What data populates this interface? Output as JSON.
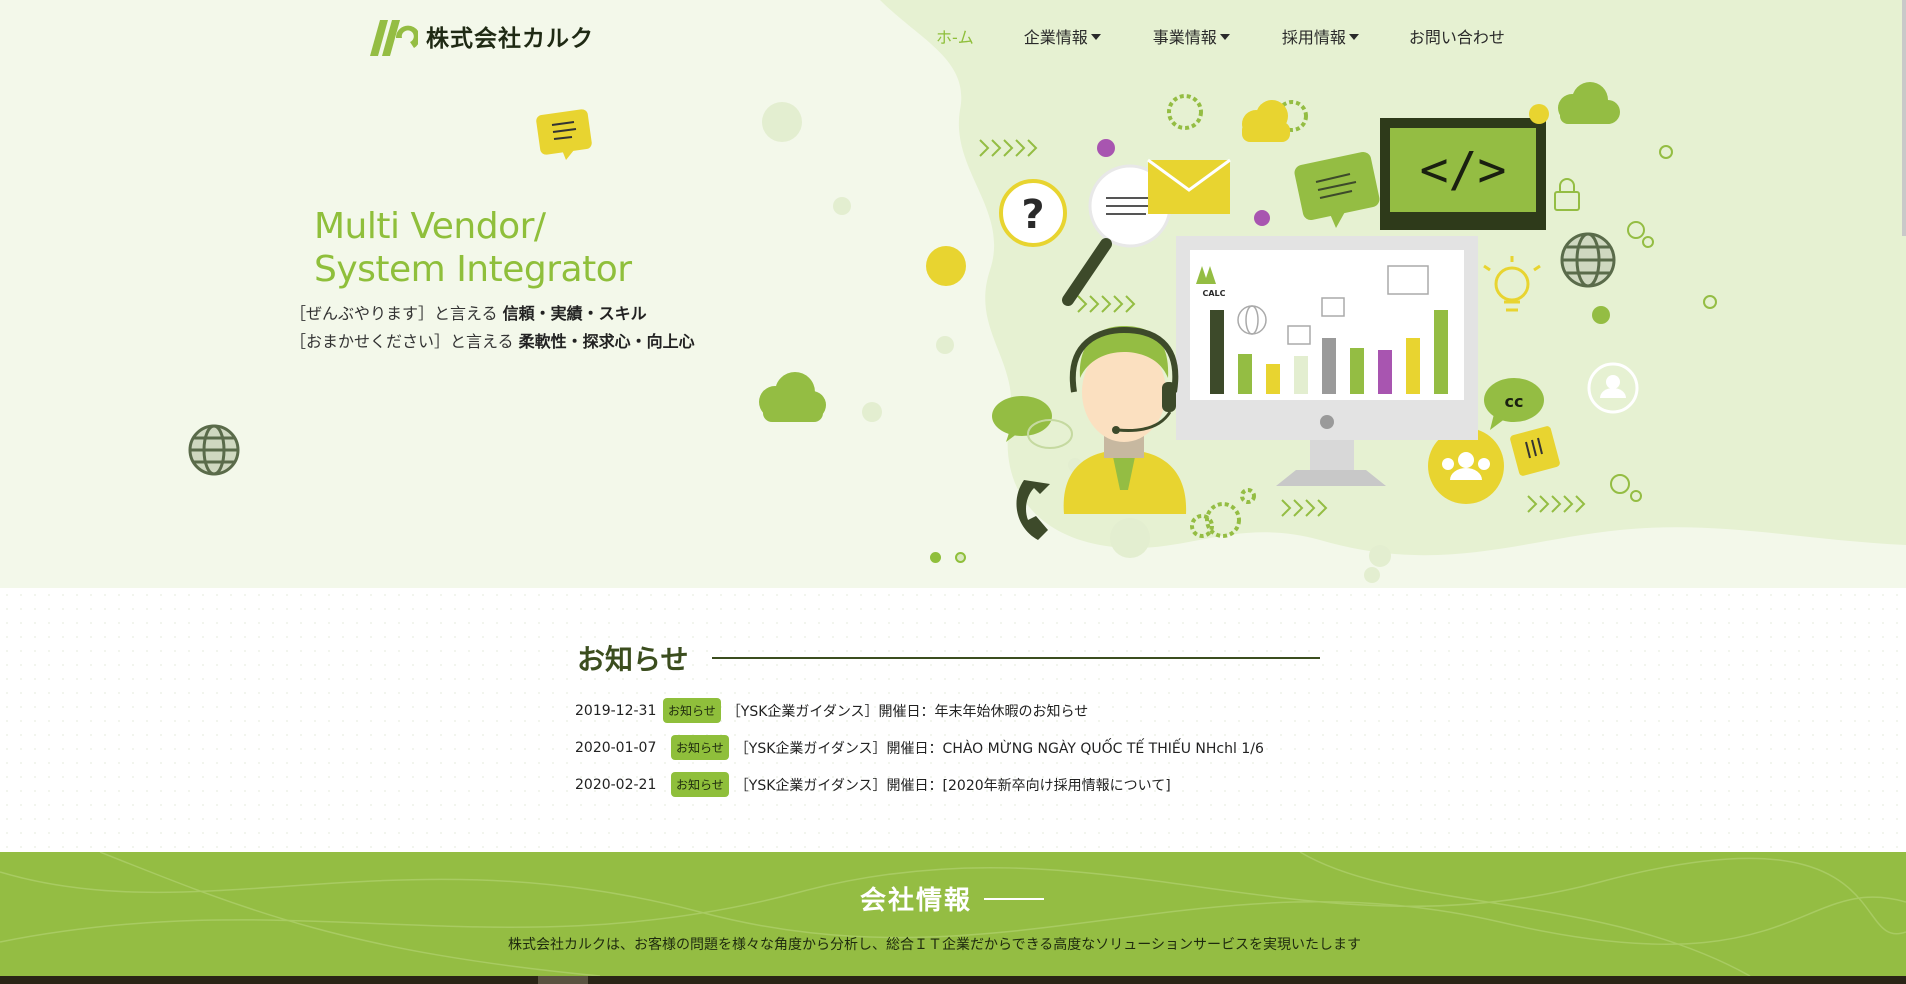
{
  "brand": {
    "name": "株式会社カルク",
    "logo_text": "CALC",
    "accent": "#8fbf3b",
    "dark": "#3b4d1e"
  },
  "nav": {
    "items": [
      {
        "label": "ホ-ム",
        "active": true,
        "has_dropdown": false
      },
      {
        "label": "企業情報",
        "active": false,
        "has_dropdown": true
      },
      {
        "label": "事業情報",
        "active": false,
        "has_dropdown": true
      },
      {
        "label": "採用情報",
        "active": false,
        "has_dropdown": true
      },
      {
        "label": "お問い合わせ",
        "active": false,
        "has_dropdown": false
      }
    ]
  },
  "hero": {
    "headline_line1": "Multi Vendor/",
    "headline_line2": "System Integrator",
    "tagline1_prefix": "［ぜんぶやります］と言える ",
    "tagline1_bold": "信頼・実績・スキル",
    "tagline2_prefix": "［おまかせください］と言える ",
    "tagline2_bold": "柔軟性・探求心・向上心",
    "illustration": {
      "code_symbol": "</>",
      "cc_label": "cc",
      "question_mark": "?"
    },
    "slides": {
      "count": 2,
      "active": 1
    }
  },
  "news": {
    "title": "お知らせ",
    "items": [
      {
        "date": "2019-12-31",
        "badge": "お知らせ",
        "text": "［YSK企業ガイダンス］開催日：年末年始休暇のお知らせ"
      },
      {
        "date": "2020-01-07",
        "badge": "お知らせ",
        "text": "［YSK企業ガイダンス］開催日：CHÀO MỪNG NGÀY QUỐC TẾ THIẾU NHchl 1/6"
      },
      {
        "date": "2020-02-21",
        "badge": "お知らせ",
        "text": "［YSK企業ガイダンス］開催日：[2020年新卒向け採用情報について]"
      }
    ]
  },
  "company": {
    "title": "会社情報",
    "description": "株式会社カルクは、お客様の問題を様々な角度から分析し、総合ＩＴ企業だからできる高度なソリューションサービスを実現いたします"
  }
}
